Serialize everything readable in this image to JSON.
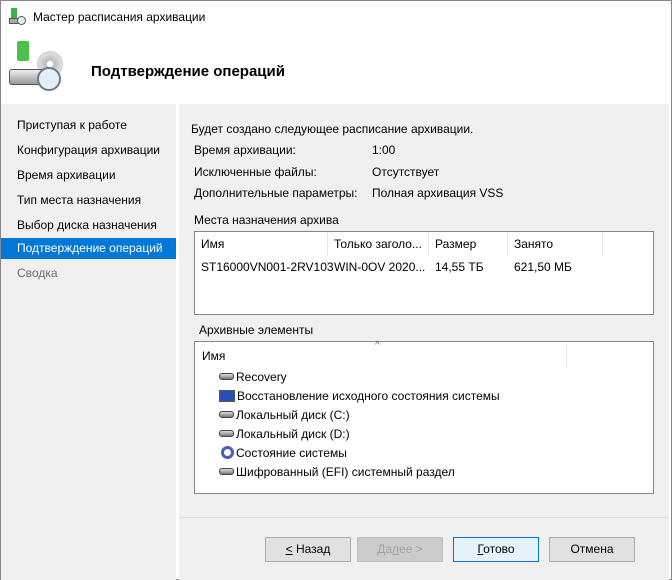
{
  "window": {
    "title": "Мастер расписания архивации",
    "header": "Подтверждение операций"
  },
  "nav": {
    "items": [
      {
        "label": "Приступая к работе",
        "state": "normal"
      },
      {
        "label": "Конфигурация архивации",
        "state": "normal"
      },
      {
        "label": "Время архивации",
        "state": "normal"
      },
      {
        "label": "Тип места назначения",
        "state": "normal"
      },
      {
        "label": "Выбор диска назначения",
        "state": "normal"
      },
      {
        "label": "Подтверждение операций",
        "state": "selected"
      },
      {
        "label": "Сводка",
        "state": "disabled"
      }
    ]
  },
  "summary": {
    "intro": "Будет создано следующее расписание архивации.",
    "rows": [
      {
        "label": "Время архивации:",
        "value": "1:00"
      },
      {
        "label": "Исключенные файлы:",
        "value": "Отсутствует"
      },
      {
        "label": "Дополнительные параметры:",
        "value": "Полная архивация VSS"
      }
    ]
  },
  "destinations": {
    "title": "Места назначения архива",
    "columns": [
      "Имя",
      "Только заголо...",
      "Размер",
      "Занято"
    ],
    "rows": [
      [
        "ST16000VN001-2RV103",
        "WIN-0OV 2020...",
        "14,55 ТБ",
        "621,50 МБ"
      ]
    ]
  },
  "items": {
    "title": "Архивные элементы",
    "column": "Имя",
    "list": [
      {
        "label": "Recovery",
        "icon": "disk-icon"
      },
      {
        "label": "Восстановление исходного состояния системы",
        "icon": "computer-icon"
      },
      {
        "label": "Локальный диск (C:)",
        "icon": "disk-icon"
      },
      {
        "label": "Локальный диск (D:)",
        "icon": "disk-icon"
      },
      {
        "label": "Состояние системы",
        "icon": "gear-icon"
      },
      {
        "label": "Шифрованный (EFI) системный раздел",
        "icon": "disk-icon"
      }
    ]
  },
  "buttons": {
    "back_key": "<",
    "back": " Назад",
    "next_pre": "Да",
    "next_key": "л",
    "next_post": "ее >",
    "finish_key": "Г",
    "finish": "отово",
    "cancel": "Отмена"
  },
  "colors": {
    "accent": "#0078d7"
  }
}
